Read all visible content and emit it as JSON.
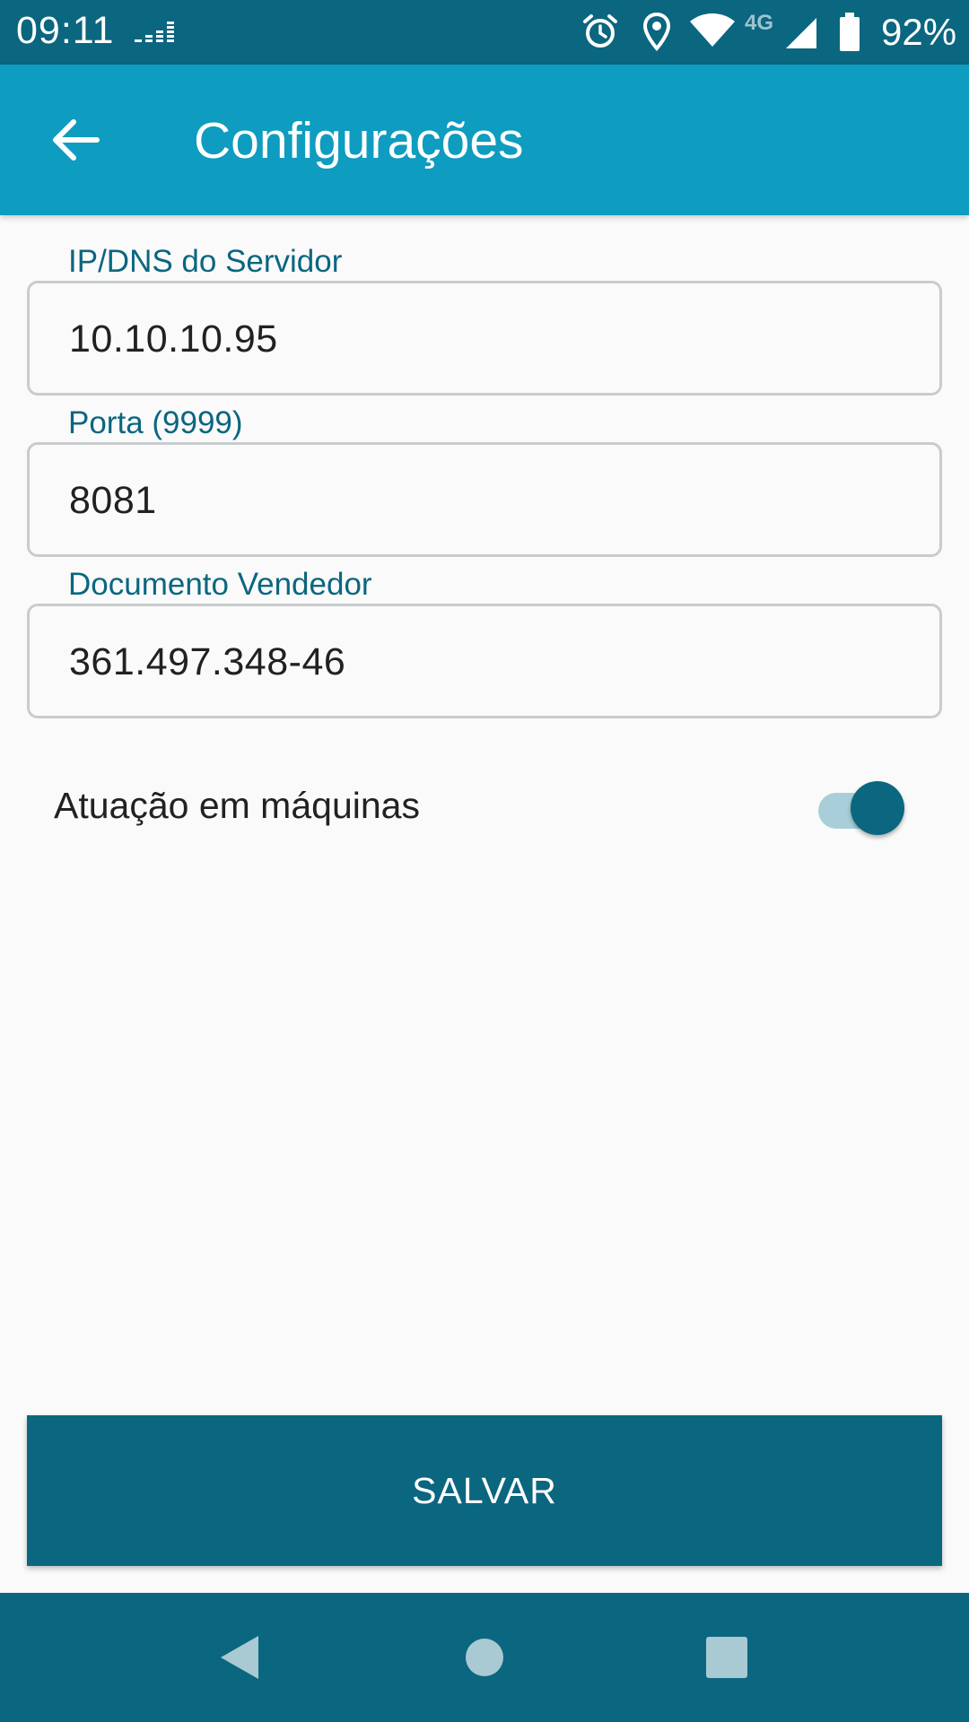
{
  "status_bar": {
    "time": "09:11",
    "network": "4G",
    "battery": "92%",
    "icons": [
      "deezer-icon",
      "alarm-icon",
      "location-icon",
      "wifi-icon",
      "signal-icon",
      "battery-icon"
    ]
  },
  "app_bar": {
    "title": "Configurações",
    "back_icon": "arrow-back-icon"
  },
  "form": {
    "server": {
      "label": "IP/DNS do Servidor",
      "value": "10.10.10.95"
    },
    "port": {
      "label": "Porta (9999)",
      "value": "8081"
    },
    "document": {
      "label": "Documento Vendedor",
      "value": "361.497.348-46"
    },
    "machines_toggle": {
      "label": "Atuação em máquinas",
      "checked": true
    }
  },
  "actions": {
    "save_label": "SALVAR"
  },
  "nav_bar": {
    "icons": [
      "nav-back-icon",
      "nav-home-icon",
      "nav-recents-icon"
    ]
  },
  "colors": {
    "status_bar": "#0b6680",
    "app_bar": "#0e9cc0",
    "accent": "#0b6680",
    "background": "#fafafa",
    "switch_track": "#a8cfd9"
  }
}
